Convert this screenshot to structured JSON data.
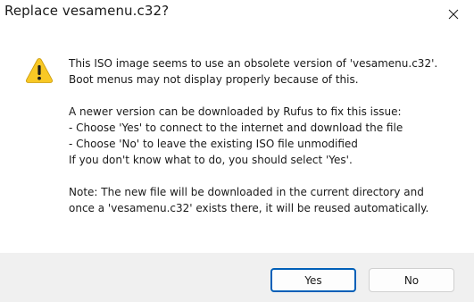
{
  "window": {
    "title": "Replace vesamenu.c32?"
  },
  "icons": {
    "warning": "warning-icon",
    "close": "close-icon"
  },
  "message": {
    "paragraphs": [
      [
        "This ISO image seems to use an obsolete version of 'vesamenu.c32'.",
        "Boot menus may not display properly because of this."
      ],
      [
        "A newer version can be downloaded by Rufus to fix this issue:",
        "- Choose 'Yes' to connect to the internet and download the file",
        "- Choose 'No' to leave the existing ISO file unmodified",
        "If you don't know what to do, you should select 'Yes'."
      ],
      [
        "Note: The new file will be downloaded in the current directory and",
        "once a 'vesamenu.c32' exists there, it will be reused automatically."
      ]
    ]
  },
  "buttons": {
    "yes_label": "Yes",
    "no_label": "No"
  },
  "colors": {
    "accent": "#005fb8",
    "warning_fill": "#f8c825",
    "footer_bg": "#f0f0f0"
  }
}
